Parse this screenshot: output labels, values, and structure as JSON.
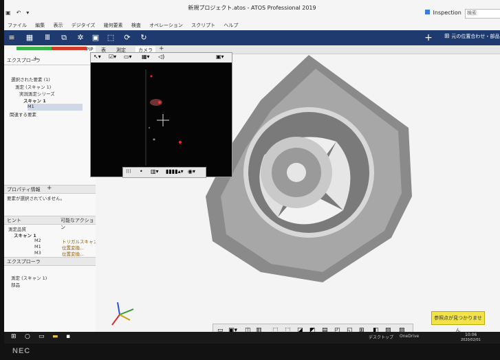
{
  "app": {
    "title": "新規プロジェクト.atos - ATOS Professional 2019",
    "workspace": "Inspection",
    "search_placeholder": "検索"
  },
  "menu": [
    "ファイル",
    "編集",
    "表示",
    "デジタイズ",
    "幾何要素",
    "検査",
    "オペレーション",
    "スクリプト",
    "ヘルプ"
  ],
  "ribbon": {
    "right_label": "元の位置合わせ・部品"
  },
  "left_panel": {
    "explorer_tab": "エクスプローラ",
    "selected_elements": "選択された要素 (1)",
    "measurement_name": "測定 (スキャン 1)",
    "series": "実測測定シリーズ",
    "scan": "スキャン 1",
    "m1": "M1",
    "related_elements": "関連する要素",
    "properties_header": "プロパティ情報",
    "properties_msg": "要素が選択されていません。",
    "filter_label": "ヒント",
    "action_label": "可能なアクション",
    "measurement_list": "測定品質",
    "scan2": "スキャン 1",
    "m2": "M2",
    "m1b": "M1",
    "m3": "M3",
    "action1": "トリガルスキャン",
    "action2": "位置変換...",
    "action3": "位置変換...",
    "explorer2": "エクスプローラ",
    "section_title": "測定 (スキャン 1)",
    "section_sub": "部品"
  },
  "tabs": [
    "PIP",
    "表",
    "測定",
    "カメラ"
  ],
  "note": "参照点が見つかりません",
  "colors": {
    "ribbon": "#1e3a6e",
    "status_green": "#3bb34a",
    "status_red": "#d23a2a",
    "note_bg": "#f3e34a"
  },
  "taskbar": {
    "app_label": "OneDrive",
    "left_label": "デスクトップ",
    "time": "10:06",
    "date": "2020/02/01"
  },
  "bezel_brand": "NEC",
  "icons": [
    "windows-start-icon",
    "search-icon",
    "task-view-icon",
    "file-explorer-icon",
    "app-icon",
    "plus-icon",
    "settings-icon",
    "camera-icon",
    "crosshair-icon",
    "axis-triad-icon"
  ]
}
